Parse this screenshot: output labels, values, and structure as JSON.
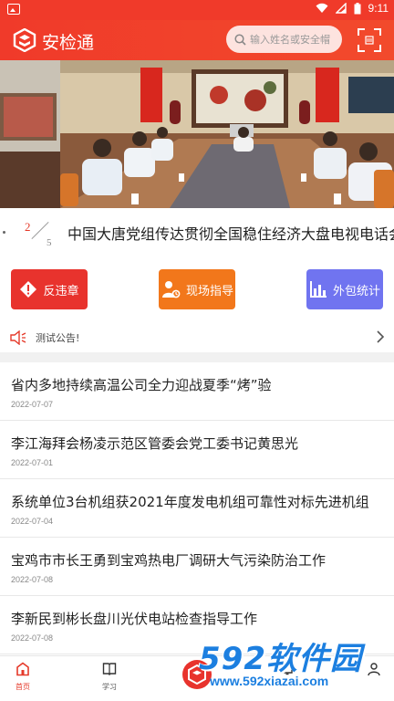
{
  "status_bar": {
    "time": "9:11"
  },
  "header": {
    "app_title": "安检通",
    "search_placeholder": "输入姓名或安全帽"
  },
  "banner": {
    "current_page": "2",
    "total_pages": "5",
    "caption": "中国大唐党组传达贯彻全国稳住经济大盘电视电话会议精神"
  },
  "actions": [
    {
      "label": "反违章",
      "icon": "warning-icon",
      "color": "#e8332d"
    },
    {
      "label": "现场指导",
      "icon": "worker-guide-icon",
      "color": "#f2771b"
    },
    {
      "label": "外包统计",
      "icon": "bar-chart-icon",
      "color": "#7074f0"
    }
  ],
  "notice": {
    "text": "测试公告!"
  },
  "news": [
    {
      "title": "省内多地持续高温公司全力迎战夏季“烤”验",
      "date": "2022-07-07"
    },
    {
      "title": "李江海拜会杨凌示范区管委会党工委书记黄思光",
      "date": "2022-07-01"
    },
    {
      "title": "系统单位3台机组获2021年度发电机组可靠性对标先进机组",
      "date": "2022-07-04"
    },
    {
      "title": "宝鸡市市长王勇到宝鸡热电厂调研大气污染防治工作",
      "date": "2022-07-08"
    },
    {
      "title": "李新民到彬长盘川光伏电站检查指导工作",
      "date": "2022-07-08"
    }
  ],
  "bottom_nav": {
    "home": "首页",
    "study": "学习"
  },
  "watermark": {
    "brand": "592软件园",
    "url": "www.592xiazai.com"
  }
}
